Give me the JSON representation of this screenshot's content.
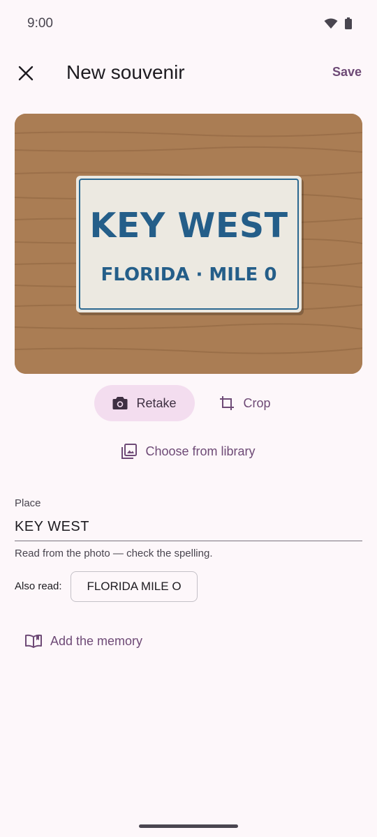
{
  "status_bar": {
    "time": "9:00"
  },
  "app_bar": {
    "title": "New souvenir",
    "save_label": "Save"
  },
  "photo": {
    "plaque_title": "KEY WEST",
    "plaque_subtitle": "FLORIDA · MILE 0"
  },
  "actions": {
    "retake_label": "Retake",
    "crop_label": "Crop",
    "library_label": "Choose from library"
  },
  "place_field": {
    "label": "Place",
    "value": "KEY WEST",
    "helper": "Read from the photo — check the spelling."
  },
  "also_read": {
    "label": "Also read:",
    "suggestion": "FLORIDA MILE O"
  },
  "memory": {
    "label": "Add the memory"
  },
  "colors": {
    "background": "#fdf7fa",
    "accent": "#6e4a76",
    "tonal_button": "#f3ddef",
    "wood": "#aa7d54",
    "plaque_text": "#245e89"
  }
}
